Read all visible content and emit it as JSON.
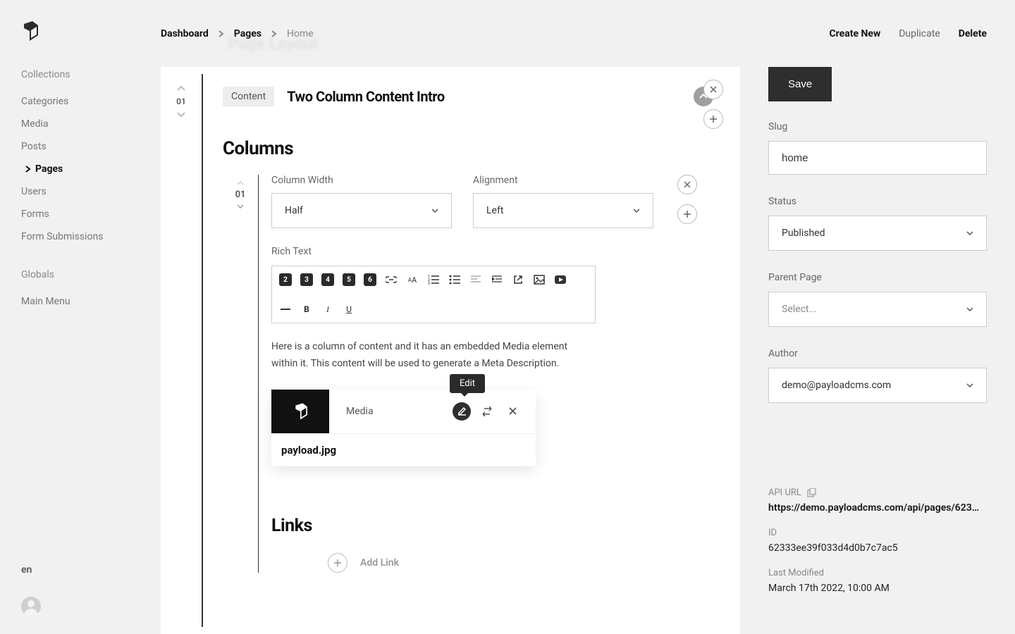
{
  "ghostTitle": "Page Layout",
  "breadcrumbs": {
    "items": [
      "Dashboard",
      "Pages",
      "Home"
    ]
  },
  "header": {
    "create": "Create New",
    "duplicate": "Duplicate",
    "delete": "Delete"
  },
  "sidebar": {
    "lang": "en",
    "groups": [
      {
        "label": "Collections",
        "items": [
          "Categories",
          "Media",
          "Posts",
          "Pages",
          "Users",
          "Forms",
          "Form Submissions"
        ],
        "activeIndex": 3
      },
      {
        "label": "Globals",
        "items": [
          "Main Menu"
        ]
      }
    ]
  },
  "block": {
    "index": "01",
    "chip": "Content",
    "title": "Two Column Content Intro",
    "sectionHeading": "Columns"
  },
  "column": {
    "index": "01",
    "widthLabel": "Column Width",
    "widthValue": "Half",
    "alignLabel": "Alignment",
    "alignValue": "Left",
    "rteLabel": "Rich Text",
    "rteText1": "Here is a column of content and it has an embedded Media element within it.",
    "rteText2": "This content will be used to generate a Meta Description."
  },
  "media": {
    "label": "Media",
    "filename": "payload.jpg",
    "tooltip": "Edit"
  },
  "links": {
    "heading": "Links",
    "add": "Add Link"
  },
  "rightPanel": {
    "save": "Save",
    "slugLabel": "Slug",
    "slugValue": "home",
    "statusLabel": "Status",
    "statusValue": "Published",
    "parentLabel": "Parent Page",
    "parentPlaceholder": "Select...",
    "authorLabel": "Author",
    "authorValue": "demo@payloadcms.com",
    "apiUrlLabel": "API URL",
    "apiUrlValue": "https://demo.payloadcms.com/api/pages/6233...",
    "idLabel": "ID",
    "idValue": "62333ee39f033d4d0b7c7ac5",
    "lastModifiedLabel": "Last Modified",
    "lastModifiedValue": "March 17th 2022, 10:00 AM"
  }
}
